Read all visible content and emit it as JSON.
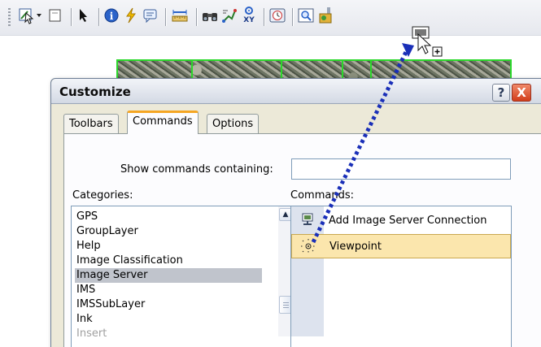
{
  "toolbar": {
    "icons": [
      "select-elements-icon",
      "dropdown-arrow-icon",
      "blank-page-icon",
      "arrow-pointer-icon",
      "identify-icon",
      "hyperlink-icon",
      "html-popup-icon",
      "measure-icon",
      "find-icon",
      "go-to-xy-icon",
      "find-route-icon",
      "time-slider-icon",
      "magnifier-window-icon",
      "add-image-server-icon"
    ]
  },
  "dialog": {
    "title": "Customize",
    "help_label": "?",
    "close_label": "X",
    "tabs": [
      "Toolbars",
      "Commands",
      "Options"
    ],
    "active_tab": "Commands",
    "show_commands_label": "Show commands containing:",
    "show_commands_value": "",
    "categories_label": "Categories:",
    "commands_label": "Commands:",
    "categories": [
      {
        "label": "GPS",
        "state": "normal"
      },
      {
        "label": "GroupLayer",
        "state": "normal"
      },
      {
        "label": "Help",
        "state": "normal"
      },
      {
        "label": "Image Classification",
        "state": "normal"
      },
      {
        "label": "Image Server",
        "state": "selected"
      },
      {
        "label": "IMS",
        "state": "normal"
      },
      {
        "label": "IMSSubLayer",
        "state": "normal"
      },
      {
        "label": "Ink",
        "state": "normal"
      },
      {
        "label": "Insert",
        "state": "dim"
      }
    ],
    "commands": [
      {
        "label": "Add Image Server Connection",
        "icon": "add-image-server-icon",
        "selected": false
      },
      {
        "label": "Viewpoint",
        "icon": "viewpoint-icon",
        "selected": true
      }
    ]
  },
  "colors": {
    "accent_tab": "#f5a623",
    "selection": "#fbe6ad",
    "drag_line": "#1a2fb8",
    "map_border": "#2bd82b"
  }
}
